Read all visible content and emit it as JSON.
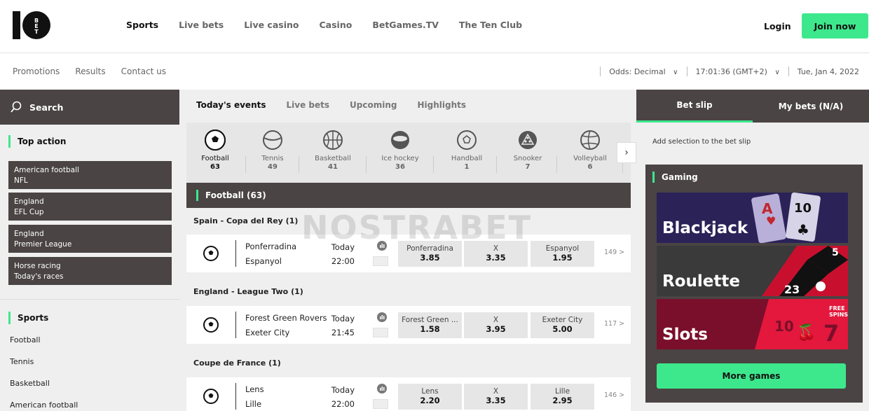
{
  "logo": {
    "text": "10BET"
  },
  "nav": {
    "items": [
      "Sports",
      "Live bets",
      "Live casino",
      "Casino",
      "BetGames.TV",
      "The Ten Club"
    ]
  },
  "auth": {
    "login": "Login",
    "join": "Join now"
  },
  "subnav": {
    "links": [
      "Promotions",
      "Results",
      "Contact us"
    ]
  },
  "settings": {
    "odds_label": "Odds:",
    "odds_value": "Decimal",
    "clock": "17:01:36 (GMT+2)",
    "date": "Tue, Jan 4, 2022"
  },
  "search": {
    "label": "Search"
  },
  "top_action": {
    "title": "Top action",
    "items": [
      {
        "line1": "American football",
        "line2": "NFL"
      },
      {
        "line1": "England",
        "line2": "EFL Cup"
      },
      {
        "line1": "England",
        "line2": "Premier League"
      },
      {
        "line1": "Horse racing",
        "line2": "Today's races"
      }
    ]
  },
  "sports_list": {
    "title": "Sports",
    "items": [
      "Football",
      "Tennis",
      "Basketball",
      "American football"
    ]
  },
  "event_tabs": [
    "Today's events",
    "Live bets",
    "Upcoming",
    "Highlights"
  ],
  "sports": [
    {
      "name": "Football",
      "count": "63",
      "icon": "football-icon"
    },
    {
      "name": "Tennis",
      "count": "49",
      "icon": "tennis-icon"
    },
    {
      "name": "Basketball",
      "count": "41",
      "icon": "basketball-icon"
    },
    {
      "name": "Ice hockey",
      "count": "36",
      "icon": "ice-hockey-icon"
    },
    {
      "name": "Handball",
      "count": "1",
      "icon": "handball-icon"
    },
    {
      "name": "Snooker",
      "count": "7",
      "icon": "snooker-icon"
    },
    {
      "name": "Volleyball",
      "count": "6",
      "icon": "volleyball-icon"
    }
  ],
  "section": {
    "title": "Football",
    "count": "(63)"
  },
  "watermark": "NOSTRABET",
  "competitions": [
    {
      "name": "Spain - Copa del Rey (1)",
      "home": "Ponferradina",
      "away": "Espanyol",
      "day": "Today",
      "time": "22:00",
      "odds": [
        {
          "label": "Ponferradina",
          "value": "3.85"
        },
        {
          "label": "X",
          "value": "3.35"
        },
        {
          "label": "Espanyol",
          "value": "1.95"
        }
      ],
      "more": "149 >"
    },
    {
      "name": "England - League Two (1)",
      "home": "Forest Green Rovers",
      "away": "Exeter City",
      "day": "Today",
      "time": "21:45",
      "odds": [
        {
          "label": "Forest Green ...",
          "value": "1.58"
        },
        {
          "label": "X",
          "value": "3.95"
        },
        {
          "label": "Exeter City",
          "value": "5.00"
        }
      ],
      "more": "117 >"
    },
    {
      "name": "Coupe de France (1)",
      "home": "Lens",
      "away": "Lille",
      "day": "Today",
      "time": "22:00",
      "odds": [
        {
          "label": "Lens",
          "value": "2.20"
        },
        {
          "label": "X",
          "value": "3.35"
        },
        {
          "label": "Lille",
          "value": "2.95"
        }
      ],
      "more": "146 >"
    }
  ],
  "betslip": {
    "tab1": "Bet slip",
    "tab2": "My bets (N/A)",
    "message": "Add selection to the bet slip"
  },
  "gaming": {
    "title": "Gaming",
    "games": [
      "Blackjack",
      "Roulette",
      "Slots"
    ],
    "more": "More games"
  },
  "colors": {
    "accent": "#3de88c",
    "dark": "#4a4444",
    "panel": "#f0efef"
  }
}
